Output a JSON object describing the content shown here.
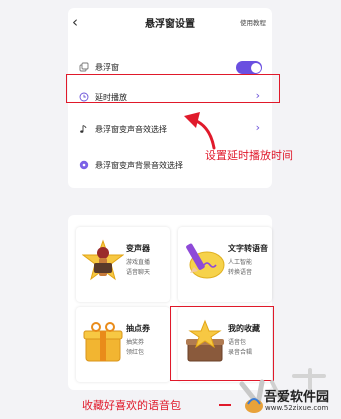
{
  "settings": {
    "back_icon": "chevron-left-icon",
    "title": "悬浮窗设置",
    "help_link": "使用教程",
    "rows": [
      {
        "icon": "window-copy-icon",
        "label": "悬浮窗",
        "control": "toggle",
        "toggle_on": true
      },
      {
        "icon": "clock-icon",
        "label": "延时播放",
        "control": "chevron"
      },
      {
        "icon": "music-note-icon",
        "label": "悬浮窗变声音效选择",
        "control": "chevron"
      },
      {
        "icon": "disc-icon",
        "label": "悬浮窗变声背景音效选择",
        "control": "none"
      }
    ]
  },
  "annotations": {
    "delay_hint": "设置延时播放时间",
    "voice_pack_hint": "收藏好喜欢的语音包"
  },
  "tiles": [
    {
      "name": "变声器",
      "sub1": "游戏直播",
      "sub2": "语音聊天",
      "icon": "microphone-star-icon"
    },
    {
      "name": "文字转语音",
      "sub1": "人工智能",
      "sub2": "转换语音",
      "icon": "pencil-speech-icon"
    },
    {
      "name": "抽点券",
      "sub1": "抽奖券",
      "sub2": "领红包",
      "icon": "gift-box-icon"
    },
    {
      "name": "我的收藏",
      "sub1": "语音包",
      "sub2": "录音合辑",
      "icon": "star-box-icon"
    }
  ],
  "watermark": {
    "title": "吾爱软件园",
    "url": "www.52zixue.com"
  },
  "colors": {
    "accent": "#6a4fe0",
    "annotation_red": "#e01a2b",
    "background": "#f3f3f6"
  }
}
